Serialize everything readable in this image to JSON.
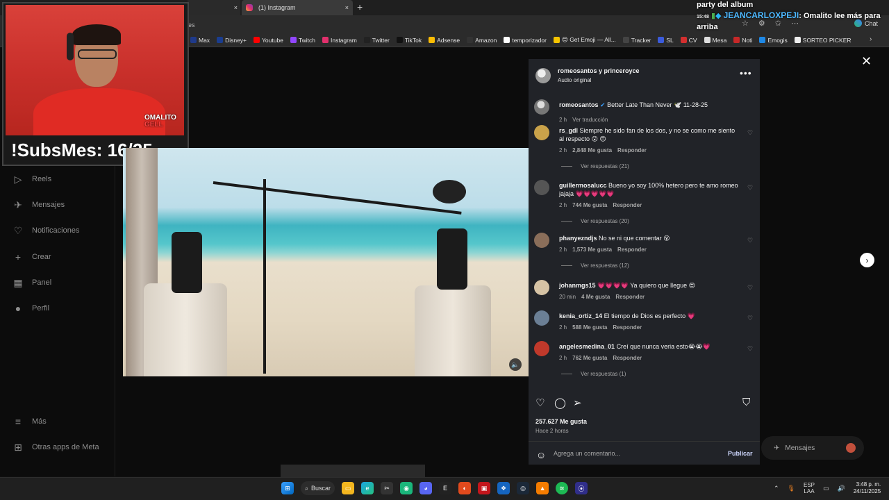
{
  "browser": {
    "prev_tab_close": "×",
    "active_tab_title": "(1) Instagram",
    "active_tab_close": "×",
    "new_tab": "+",
    "url_fragment": "es",
    "chat_label": "Chat",
    "bookmarks": [
      {
        "label": "Max",
        "color": "#1f3a8a"
      },
      {
        "label": "Disney+",
        "color": "#1a3d8f"
      },
      {
        "label": "Youtube",
        "color": "#ff0000"
      },
      {
        "label": "Twitch",
        "color": "#9146ff"
      },
      {
        "label": "Instagram",
        "color": "#e1306c"
      },
      {
        "label": "Twitter",
        "color": "#222222"
      },
      {
        "label": "TikTok",
        "color": "#111111"
      },
      {
        "label": "Adsense",
        "color": "#fbbc04"
      },
      {
        "label": "Amazon",
        "color": "#333333"
      },
      {
        "label": "temporizador",
        "color": "#ffffff"
      },
      {
        "label": "😊 Get Emoji — All...",
        "color": "#f5c400"
      },
      {
        "label": "Tracker",
        "color": "#444444"
      },
      {
        "label": "SL",
        "color": "#3b5bdb"
      },
      {
        "label": "CV",
        "color": "#d32f2f"
      },
      {
        "label": "Mesa",
        "color": "#dddddd"
      },
      {
        "label": "Noti",
        "color": "#c62828"
      },
      {
        "label": "Emogis",
        "color": "#1e88e5"
      },
      {
        "label": "SORTEO PICKER",
        "color": "#eeeeee"
      }
    ]
  },
  "stream": {
    "subs_label": "!SubsMes: 16/25",
    "logo_top": "OMALITO",
    "logo_bottom": "GELL",
    "chat": {
      "top_line": "party del album",
      "time": "15:48",
      "username": "JEANCARLOXPEJI",
      "message": ": Omalito lee más para arriba"
    }
  },
  "ig_nav": [
    {
      "label": "Reels",
      "icon": "reels-icon",
      "glyph": "▷"
    },
    {
      "label": "Mensajes",
      "icon": "messages-icon",
      "glyph": "✈"
    },
    {
      "label": "Notificaciones",
      "icon": "heart-icon",
      "glyph": "♡"
    },
    {
      "label": "Crear",
      "icon": "plus-icon",
      "glyph": "+"
    },
    {
      "label": "Panel",
      "icon": "panel-icon",
      "glyph": "▦"
    },
    {
      "label": "Perfil",
      "icon": "profile-icon",
      "glyph": "●"
    },
    {
      "label": "Más",
      "icon": "menu-icon",
      "glyph": "≡"
    },
    {
      "label": "Otras apps de Meta",
      "icon": "meta-apps-icon",
      "glyph": "⊞"
    }
  ],
  "panel": {
    "header_title": "romeosantos y princeroyce",
    "header_sub": "Audio original",
    "caption": {
      "user": "romeosantos",
      "text": "Better Late Than Never 🕊️ 11-28-25",
      "time": "2 h",
      "translate": "Ver traducción"
    },
    "comments": [
      {
        "user": "rs_gdl",
        "text": "Siempre he sido fan de los dos, y no se como me siento al respecto 😮 😍",
        "time": "2 h",
        "likes": "2,848 Me gusta",
        "reply": "Responder",
        "replies": "Ver respuestas (21)"
      },
      {
        "user": "guillermosalucc",
        "text": "Bueno yo soy 100% hetero pero te amo romeo jajaja 💗💗💗💗💗",
        "time": "2 h",
        "likes": "744 Me gusta",
        "reply": "Responder",
        "replies": "Ver respuestas (20)"
      },
      {
        "user": "phanyezndjs",
        "text": "No se ni que comentar 😵",
        "time": "2 h",
        "likes": "1,573 Me gusta",
        "reply": "Responder",
        "replies": "Ver respuestas (12)"
      },
      {
        "user": "johanmgs15",
        "text": "💗💗💗💗 Ya quiero que llegue 😍",
        "time": "20 min",
        "likes": "4 Me gusta",
        "reply": "Responder",
        "replies": ""
      },
      {
        "user": "kenia_ortiz_14",
        "text": "El tiempo de Dios es perfecto 💗",
        "time": "2 h",
        "likes": "588 Me gusta",
        "reply": "Responder",
        "replies": ""
      },
      {
        "user": "angelesmedina_01",
        "text": "Creí que nunca veria esto😭😭💗",
        "time": "2 h",
        "likes": "762 Me gusta",
        "reply": "Responder",
        "replies": "Ver respuestas (1)"
      }
    ],
    "likes_total": "257.627 Me gusta",
    "posted_ago": "Hace 2 horas",
    "comment_placeholder": "Agrega un comentario...",
    "publish_label": "Publicar"
  },
  "messages_pill": "Mensajes",
  "taskbar": {
    "search_label": "Buscar",
    "lang_top": "ESP",
    "lang_bottom": "LAA",
    "time": "3:48 p. m.",
    "date": "24/11/2025"
  }
}
